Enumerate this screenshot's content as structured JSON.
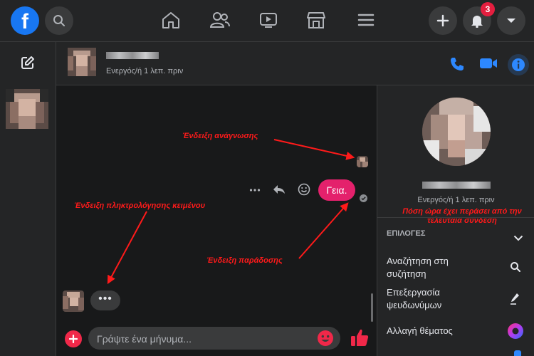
{
  "topbar": {
    "logo_letter": "f",
    "notification_count": "3"
  },
  "chat": {
    "status": "Ενεργός/ή 1 λεπ. πριν",
    "sent_message": "Γεια.",
    "typing_dots": "•••"
  },
  "annotations": {
    "read_receipt": "Ένδειξη ανάγνωσης",
    "typing_indicator": "Ένδειξη πληκτρολόγησης κειμένου",
    "delivery_indicator": "Ένδειξη παράδοσης",
    "last_seen": "Πόση ώρα έχει περάσει από την τελευταία σύνδεση"
  },
  "right_panel": {
    "status": "Ενεργός/ή 1 λεπ. πριν",
    "options_heading": "ΕΠΙΛΟΓΕΣ",
    "options": [
      {
        "label": "Αναζήτηση στη συζήτηση",
        "icon": "search-icon"
      },
      {
        "label": "Επεξεργασία ψευδωνύμων",
        "icon": "pencil-icon"
      },
      {
        "label": "Αλλαγή θέματος",
        "icon": "theme-icon"
      }
    ]
  },
  "composer": {
    "placeholder": "Γράψτε ένα μήνυμα..."
  },
  "colors": {
    "accent": "#1877f2",
    "message_bubble": "#e4216c",
    "annotation": "#ff1a1a",
    "background": "#18191a",
    "panel": "#242526"
  }
}
